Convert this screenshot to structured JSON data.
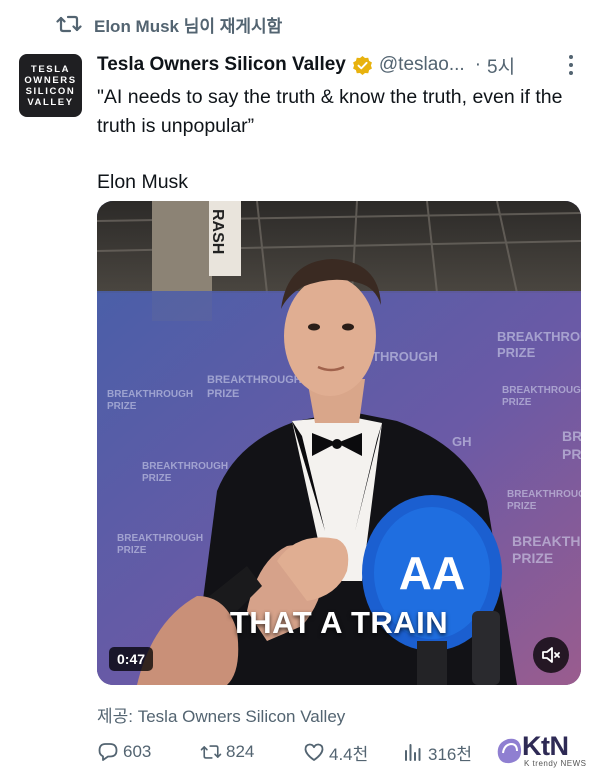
{
  "repost": {
    "label": "Elon Musk 님이 재게시함",
    "icon": "repost-icon"
  },
  "avatar": {
    "lines": [
      "TESLA",
      "OWNERS",
      "SILICON",
      "VALLEY"
    ]
  },
  "tweet": {
    "author": "Tesla Owners Silicon Valley",
    "verified": true,
    "badge_color": "#e8b20e",
    "handle": "@teslao...",
    "separator": "·",
    "time": "5시",
    "text_quote": "\"AI needs to say the truth & know the truth, even if the truth is unpopular”",
    "text_attribution": "Elon Musk"
  },
  "media": {
    "timestamp": "0:47",
    "caption": "THAT A TRAIN",
    "backdrop_text": "BREAKTHROUGH PRIZE",
    "sign_text": "RASH",
    "microphone_text": "AA",
    "mute_icon": "volume-muted-icon"
  },
  "source": {
    "label": "제공: Tesla Owners Silicon Valley"
  },
  "actions": {
    "replies": "603",
    "reposts": "824",
    "likes": "4.4천",
    "views": "316천"
  },
  "watermark": {
    "brand": "KtN",
    "sub": "K trendy NEWS"
  },
  "colors": {
    "text": "#0f1419",
    "muted": "#536471",
    "verified_gold": "#e8b20e"
  }
}
